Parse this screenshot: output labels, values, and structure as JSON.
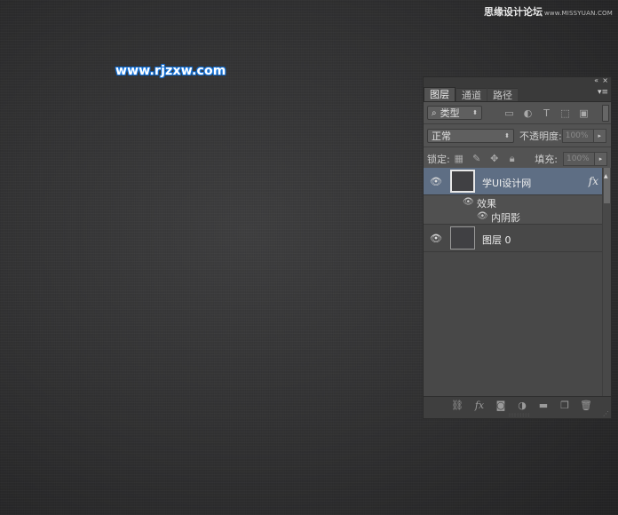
{
  "watermark": {
    "text": "思缘设计论坛",
    "url": "www.MISSYUAN.COM"
  },
  "site_logo": "www.rjzxw.com",
  "panel": {
    "titlebar": {
      "collapse_icon": "«",
      "close_icon": "×"
    },
    "tabs": [
      {
        "label": "图层",
        "active": true
      },
      {
        "label": "通道",
        "active": false
      },
      {
        "label": "路径",
        "active": false
      }
    ],
    "menu_icon": "▾≡",
    "filter": {
      "search_icon": "⌕",
      "kind_label": "类型",
      "arrow": "⬍",
      "icons": [
        "image-filter-icon",
        "adjustment-filter-icon",
        "type-filter-icon",
        "shape-filter-icon",
        "smart-object-filter-icon"
      ]
    },
    "blend_mode": "正常",
    "opacity_label": "不透明度:",
    "opacity_value": "100%",
    "lock_label": "锁定:",
    "fill_label": "填充:",
    "fill_value": "100%",
    "layers": [
      {
        "name": "学UI设计网",
        "selected": true,
        "fx": "fx",
        "effects_label": "效果",
        "effects": [
          "内阴影"
        ]
      },
      {
        "name": "图层 0",
        "selected": false
      }
    ],
    "footer_icons": [
      "link-icon",
      "fx-icon",
      "mask-icon",
      "adjustment-icon",
      "group-folder-icon",
      "new-layer-icon",
      "trash-icon"
    ]
  },
  "colors": {
    "selected_layer": "#5e6e84",
    "panel_bg": "#535353",
    "logo_blue": "#1266c7"
  }
}
